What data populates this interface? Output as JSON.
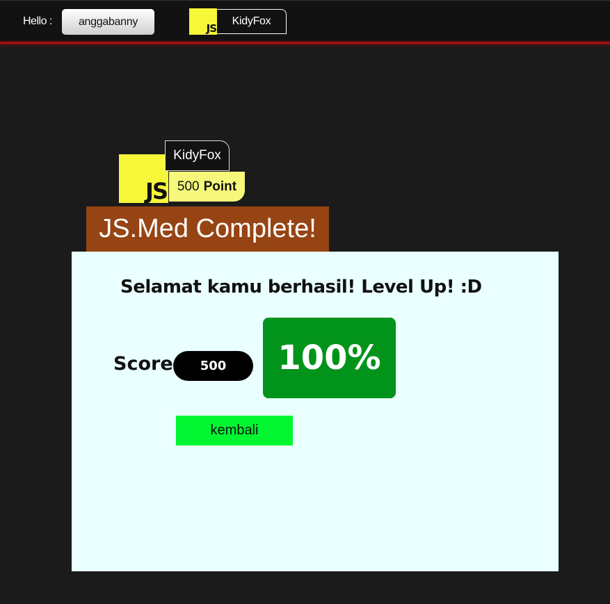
{
  "header": {
    "hello_label": "Hello :",
    "username": "anggabanny",
    "js_badge": "JS",
    "user_chip": "KidyFox"
  },
  "profile": {
    "js_badge": "JS",
    "name": "KidyFox",
    "points_value": "500",
    "points_unit": "Point"
  },
  "banner": {
    "title": "JS.Med Complete!"
  },
  "result": {
    "message": "Selamat kamu berhasil! Level Up! :D",
    "score_label": "Score",
    "score_value": "500",
    "percentage": "100%",
    "back_button": "kembali"
  },
  "colors": {
    "background": "#1b1b1b",
    "topbar": "#121212",
    "topbar_line": "#a80f0f",
    "js_yellow": "#f7f73a",
    "points_yellow": "#f5f87a",
    "banner_brown": "#964414",
    "card_background": "#eaffff",
    "percent_green": "#02941a",
    "button_green": "#01f631"
  }
}
